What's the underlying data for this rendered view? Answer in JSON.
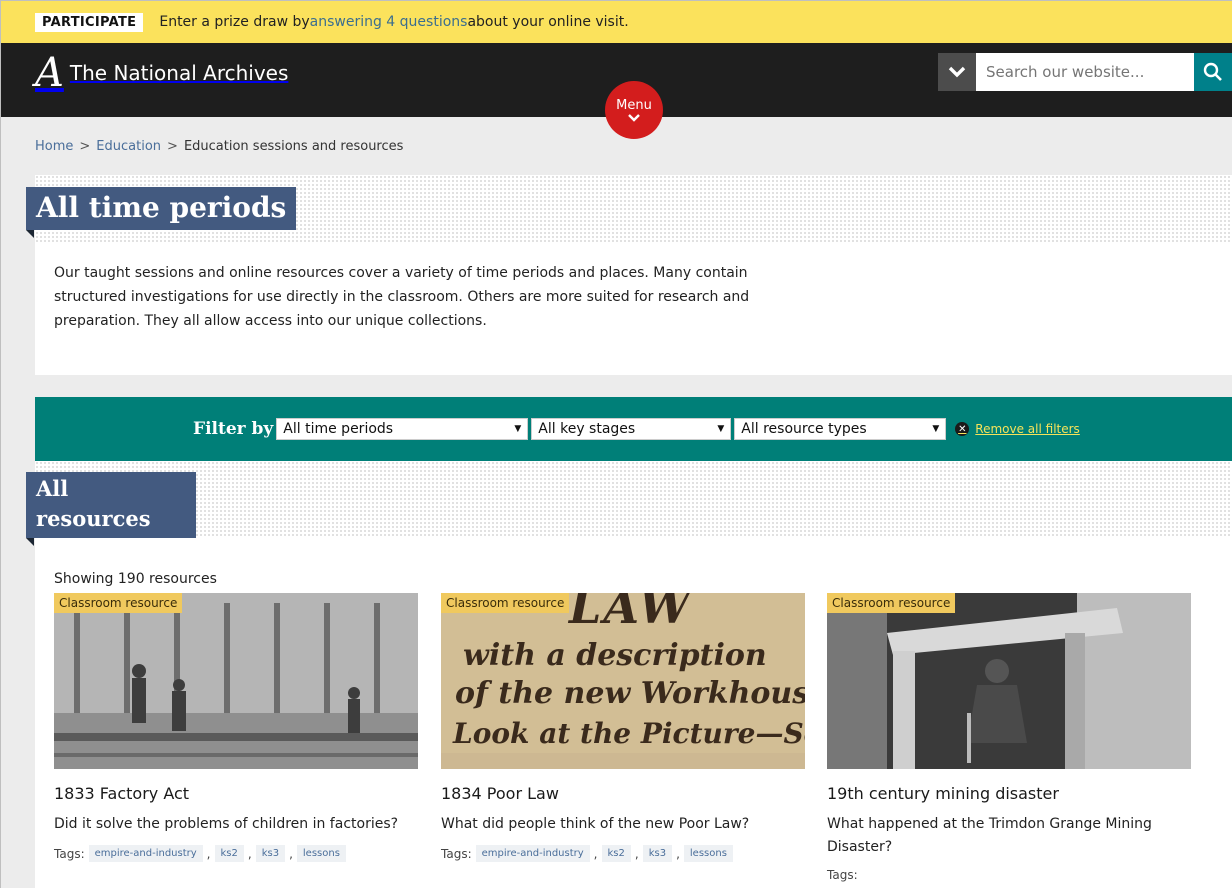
{
  "banner": {
    "tag": "PARTICIPATE",
    "text_before": "Enter a prize draw by ",
    "link": "answering 4 questions",
    "text_after": " about your online visit."
  },
  "header": {
    "logo_mark": "A",
    "site_name": "The National Archives",
    "search_placeholder": "Search our website...",
    "menu_label": "Menu"
  },
  "breadcrumb": {
    "items": [
      "Home",
      "Education"
    ],
    "current": "Education sessions and resources",
    "separator": ">"
  },
  "intro": {
    "title": "All time periods",
    "text": "Our taught sessions and online resources cover a variety of time periods and places. Many contain structured investigations for use directly in the classroom. Others are more suited for research and preparation. They all allow access into our unique collections."
  },
  "filter": {
    "label": "Filter by",
    "time_period": "All time periods",
    "key_stage": "All key stages",
    "resource_type": "All resource types",
    "remove": "Remove all filters"
  },
  "resources": {
    "title": "All resources",
    "count_text": "Showing 190 resources",
    "cards": [
      {
        "badge": "Classroom resource",
        "title": "1833 Factory Act",
        "question": "Did it solve the problems of children in factories?",
        "tags_label": "Tags:",
        "tags": [
          "empire-and-industry",
          "ks2",
          "ks3",
          "lessons"
        ]
      },
      {
        "badge": "Classroom resource",
        "title": "1834 Poor Law",
        "question": "What did people think of the new Poor Law?",
        "tags_label": "Tags:",
        "tags": [
          "empire-and-industry",
          "ks2",
          "ks3",
          "lessons"
        ],
        "image_text": [
          "with a description",
          "of the new Workhouses",
          "Look at the Picture—See"
        ]
      },
      {
        "badge": "Classroom resource",
        "title": "19th century mining disaster",
        "question": "What happened at the Trimdon Grange Mining Disaster?",
        "tags_label": "Tags:"
      }
    ]
  },
  "colors": {
    "banner": "#fbe25c",
    "header": "#1e1e1e",
    "menu": "#d31d1d",
    "teal": "#007f78",
    "heading": "#435a80",
    "badge": "#f0c95e"
  }
}
